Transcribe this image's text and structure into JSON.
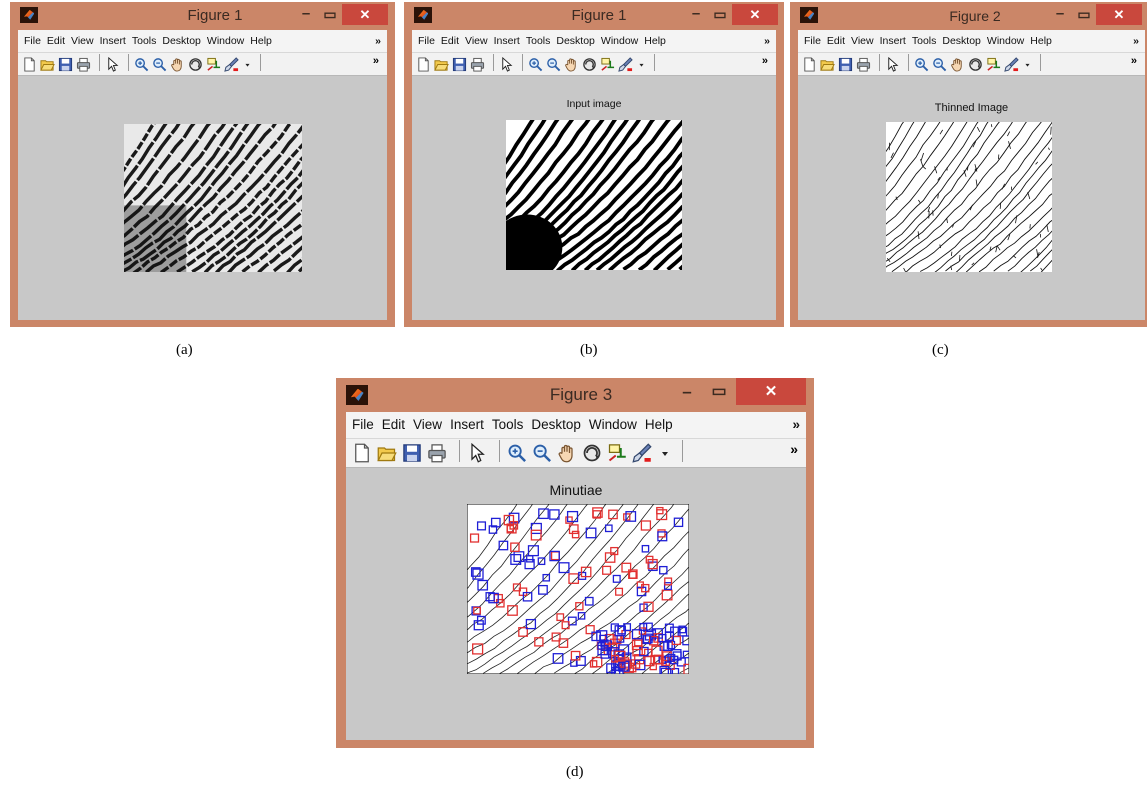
{
  "windows": [
    {
      "id": "a",
      "title": "Figure 1",
      "axes_title": "",
      "image": "grayscale fingerprint"
    },
    {
      "id": "b",
      "title": "Figure 1",
      "axes_title": "Input image",
      "image": "binarized fingerprint"
    },
    {
      "id": "c",
      "title": "Figure 2",
      "axes_title": "Thinned Image",
      "image": "thinned fingerprint"
    },
    {
      "id": "d",
      "title": "Figure 3",
      "axes_title": "Minutiae",
      "image": "thinned fingerprint with minutiae markers"
    }
  ],
  "menu": [
    "File",
    "Edit",
    "View",
    "Insert",
    "Tools",
    "Desktop",
    "Window",
    "Help"
  ],
  "menu_overflow": "»",
  "toolbar_overflow": "»",
  "toolbar_icons": [
    "new-figure-icon",
    "open-file-icon",
    "save-icon",
    "print-icon",
    "pointer-icon",
    "zoom-in-icon",
    "zoom-out-icon",
    "pan-hand-icon",
    "rotate-3d-icon",
    "data-cursor-icon",
    "brush-icon",
    "dropdown-arrow-icon"
  ],
  "window_controls": {
    "minimize": "–",
    "maximize": "▭",
    "close": "✕"
  },
  "captions": [
    "(a)",
    "(b)",
    "(c)",
    "(d)"
  ],
  "colors": {
    "frame": "#cb8668",
    "close_button": "#c9483d",
    "figure_bg": "#c8c8c8",
    "toolbar_bg": "#f2f2f2",
    "minutia_ending": "#e23030",
    "minutia_bifurcation": "#1f1fd6"
  }
}
